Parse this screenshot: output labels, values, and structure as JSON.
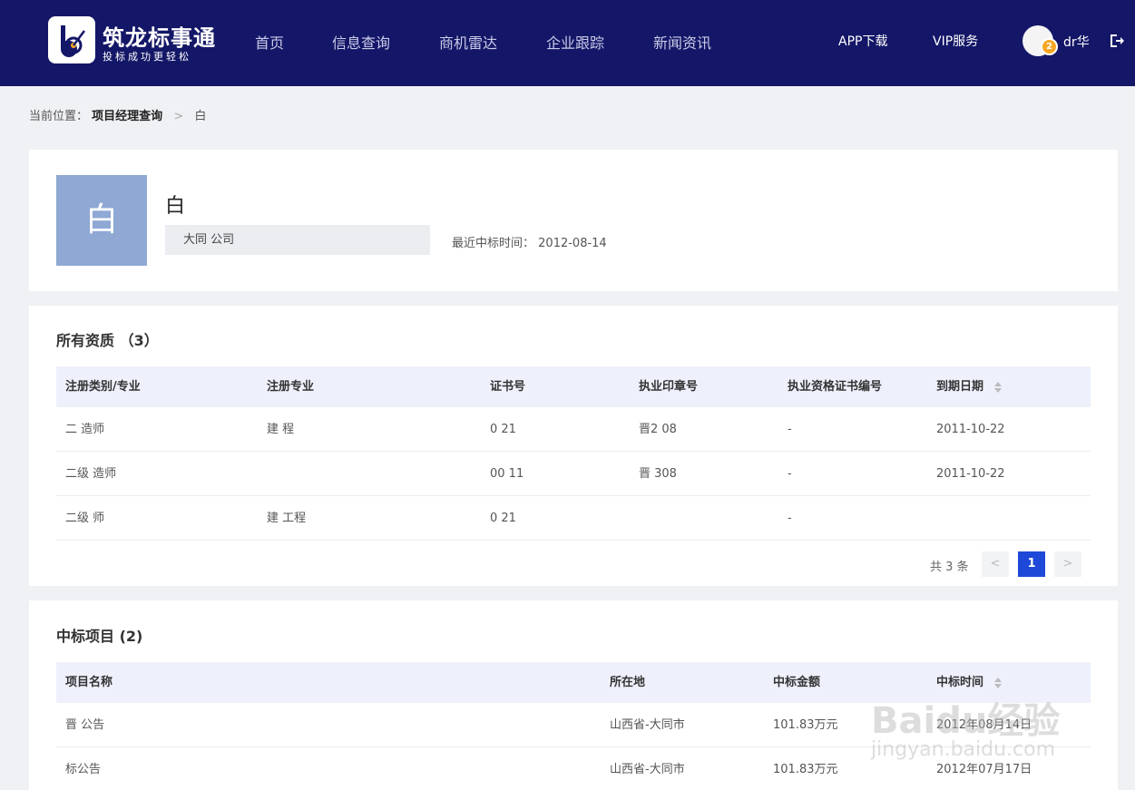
{
  "header": {
    "logo_title": "筑龙标事通",
    "logo_slogan": "投标成功更轻松",
    "nav": [
      "首页",
      "信息查询",
      "商机雷达",
      "企业跟踪",
      "新闻资讯"
    ],
    "app_download": "APP下载",
    "vip_service": "VIP服务",
    "user_badge": "2",
    "username": "dr华"
  },
  "breadcrumb": {
    "prefix": "当前位置：",
    "level1": "项目经理查询",
    "separator": ">",
    "current": "白"
  },
  "profile": {
    "avatar_char": "白",
    "name": "白",
    "company": "大同            公司",
    "latest_label": "最近中标时间：",
    "latest_date": "2012-08-14"
  },
  "qualifications": {
    "title": "所有资质 （3）",
    "columns": [
      "注册类别/专业",
      "注册专业",
      "证书号",
      "执业印章号",
      "执业资格证书编号",
      "到期日期"
    ],
    "rows": [
      [
        "二       造师",
        "建    程",
        "0      21",
        "晋2         08",
        "-",
        "2011-10-22"
      ],
      [
        "二级      造师",
        "",
        "00     11",
        "晋          308",
        "-",
        "2011-10-22"
      ],
      [
        "二级       师",
        "建   工程",
        "0      21",
        "",
        "-",
        ""
      ]
    ],
    "pager": {
      "total": "共 3 条",
      "prev": "<",
      "current": "1",
      "next": ">"
    }
  },
  "projects": {
    "title": "中标项目 (2)",
    "columns": [
      "项目名称",
      "所在地",
      "中标金额",
      "中标时间"
    ],
    "rows": [
      [
        "晋                    公告",
        "山西省-大同市",
        "101.83万元",
        "2012年08月14日"
      ],
      [
        "              标公告",
        "山西省-大同市",
        "101.83万元",
        "2012年07月17日"
      ]
    ]
  },
  "watermark": {
    "line1": "Baidu经验",
    "line2": "jingyan.baidu.com"
  },
  "colors": {
    "header_bg": "#141767",
    "accent": "#1e48d8",
    "avatar_bg": "#8fa8d4",
    "table_head_bg": "#eef1fc",
    "badge": "#f5a623"
  }
}
